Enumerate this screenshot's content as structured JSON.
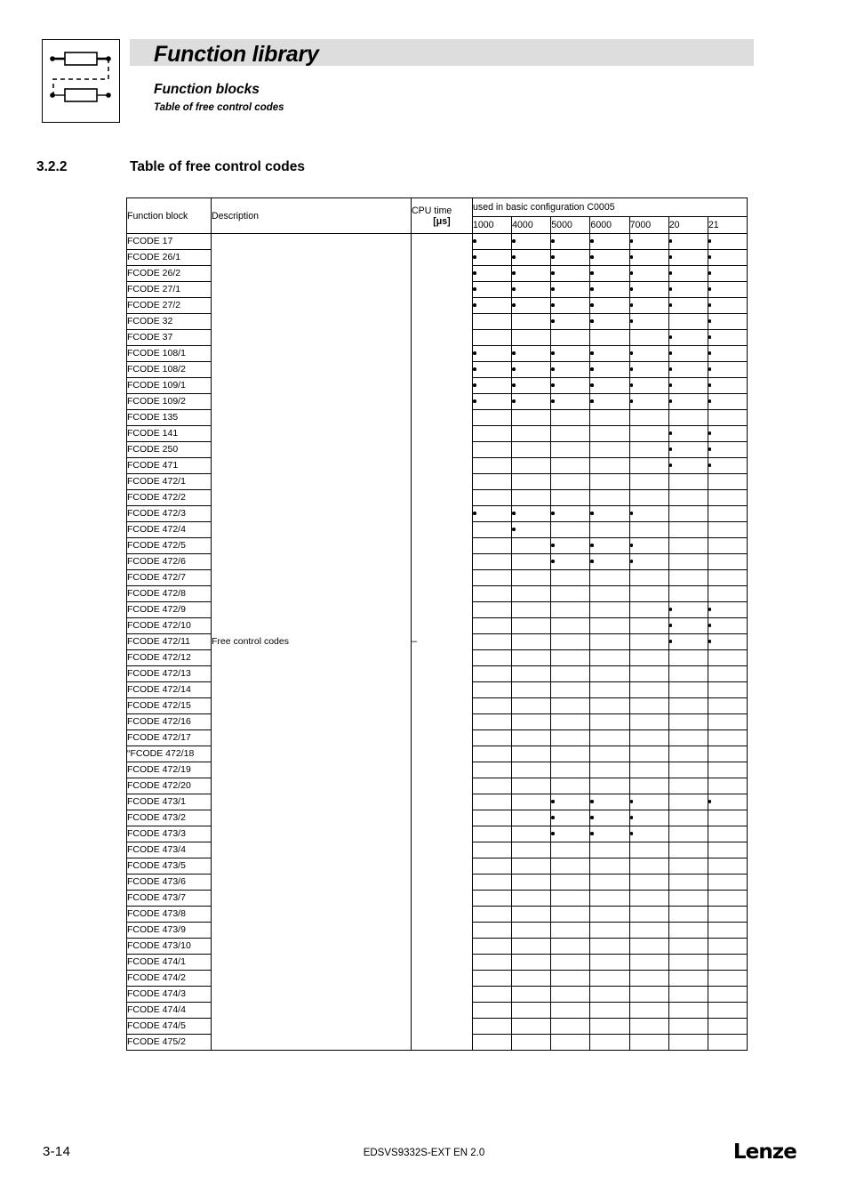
{
  "header": {
    "title": "Function library",
    "subtitle": "Function blocks",
    "subsubtitle": "Table of free control codes",
    "icon_name": "function-block-diagram-icon"
  },
  "section": {
    "number": "3.2.2",
    "title": "Table of free control codes"
  },
  "table": {
    "columns": {
      "function_block": "Function block",
      "description": "Description",
      "cpu_time": "CPU time",
      "cpu_time_unit": "[μs]",
      "config_group": "used in basic configuration C0005",
      "config_columns": [
        "1000",
        "4000",
        "5000",
        "6000",
        "7000",
        "20",
        "21"
      ]
    },
    "dot_glyph": "•",
    "description_value": "Free control codes",
    "cpu_time_value": "–",
    "rows": [
      {
        "name": "FCODE 17",
        "flags": [
          1,
          1,
          1,
          1,
          1,
          1,
          1
        ]
      },
      {
        "name": "FCODE 26/1",
        "flags": [
          1,
          1,
          1,
          1,
          1,
          1,
          1
        ]
      },
      {
        "name": "FCODE 26/2",
        "flags": [
          1,
          1,
          1,
          1,
          1,
          1,
          1
        ]
      },
      {
        "name": "FCODE 27/1",
        "flags": [
          1,
          1,
          1,
          1,
          1,
          1,
          1
        ]
      },
      {
        "name": "FCODE 27/2",
        "flags": [
          1,
          1,
          1,
          1,
          1,
          1,
          1
        ]
      },
      {
        "name": "FCODE 32",
        "flags": [
          0,
          0,
          1,
          1,
          1,
          0,
          1
        ]
      },
      {
        "name": "FCODE 37",
        "flags": [
          0,
          0,
          0,
          0,
          0,
          1,
          1
        ]
      },
      {
        "name": "FCODE 108/1",
        "flags": [
          1,
          1,
          1,
          1,
          1,
          1,
          1
        ]
      },
      {
        "name": "FCODE 108/2",
        "flags": [
          1,
          1,
          1,
          1,
          1,
          1,
          1
        ]
      },
      {
        "name": "FCODE 109/1",
        "flags": [
          1,
          1,
          1,
          1,
          1,
          1,
          1
        ]
      },
      {
        "name": "FCODE 109/2",
        "flags": [
          1,
          1,
          1,
          1,
          1,
          1,
          1
        ]
      },
      {
        "name": "FCODE 135",
        "flags": [
          0,
          0,
          0,
          0,
          0,
          0,
          0
        ]
      },
      {
        "name": "FCODE 141",
        "flags": [
          0,
          0,
          0,
          0,
          0,
          1,
          1
        ]
      },
      {
        "name": "FCODE 250",
        "flags": [
          0,
          0,
          0,
          0,
          0,
          1,
          1
        ]
      },
      {
        "name": "FCODE 471",
        "flags": [
          0,
          0,
          0,
          0,
          0,
          1,
          1
        ]
      },
      {
        "name": "FCODE 472/1",
        "flags": [
          0,
          0,
          0,
          0,
          0,
          0,
          0
        ]
      },
      {
        "name": "FCODE 472/2",
        "flags": [
          0,
          0,
          0,
          0,
          0,
          0,
          0
        ]
      },
      {
        "name": "FCODE 472/3",
        "flags": [
          1,
          1,
          1,
          1,
          1,
          0,
          0
        ]
      },
      {
        "name": "FCODE 472/4",
        "flags": [
          0,
          1,
          0,
          0,
          0,
          0,
          0
        ]
      },
      {
        "name": "FCODE 472/5",
        "flags": [
          0,
          0,
          1,
          1,
          1,
          0,
          0
        ]
      },
      {
        "name": "FCODE 472/6",
        "flags": [
          0,
          0,
          1,
          1,
          1,
          0,
          0
        ]
      },
      {
        "name": "FCODE 472/7",
        "flags": [
          0,
          0,
          0,
          0,
          0,
          0,
          0
        ]
      },
      {
        "name": "FCODE 472/8",
        "flags": [
          0,
          0,
          0,
          0,
          0,
          0,
          0
        ]
      },
      {
        "name": "FCODE 472/9",
        "flags": [
          0,
          0,
          0,
          0,
          0,
          1,
          1
        ]
      },
      {
        "name": "FCODE 472/10",
        "flags": [
          0,
          0,
          0,
          0,
          0,
          1,
          1
        ]
      },
      {
        "name": "FCODE 472/11",
        "flags": [
          0,
          0,
          0,
          0,
          0,
          1,
          1
        ]
      },
      {
        "name": "FCODE 472/12",
        "flags": [
          0,
          0,
          0,
          0,
          0,
          0,
          0
        ]
      },
      {
        "name": "FCODE 472/13",
        "flags": [
          0,
          0,
          0,
          0,
          0,
          0,
          0
        ]
      },
      {
        "name": "FCODE 472/14",
        "flags": [
          0,
          0,
          0,
          0,
          0,
          0,
          0
        ]
      },
      {
        "name": "FCODE 472/15",
        "flags": [
          0,
          0,
          0,
          0,
          0,
          0,
          0
        ]
      },
      {
        "name": "FCODE 472/16",
        "flags": [
          0,
          0,
          0,
          0,
          0,
          0,
          0
        ]
      },
      {
        "name": "FCODE 472/17",
        "flags": [
          0,
          0,
          0,
          0,
          0,
          0,
          0
        ]
      },
      {
        "name": "“FCODE 472/18",
        "flags": [
          0,
          0,
          0,
          0,
          0,
          0,
          0
        ]
      },
      {
        "name": "FCODE 472/19",
        "flags": [
          0,
          0,
          0,
          0,
          0,
          0,
          0
        ]
      },
      {
        "name": "FCODE 472/20",
        "flags": [
          0,
          0,
          0,
          0,
          0,
          0,
          0
        ]
      },
      {
        "name": "FCODE 473/1",
        "flags": [
          0,
          0,
          1,
          1,
          1,
          0,
          1
        ]
      },
      {
        "name": "FCODE 473/2",
        "flags": [
          0,
          0,
          1,
          1,
          1,
          0,
          0
        ]
      },
      {
        "name": "FCODE 473/3",
        "flags": [
          0,
          0,
          1,
          1,
          1,
          0,
          0
        ]
      },
      {
        "name": "FCODE 473/4",
        "flags": [
          0,
          0,
          0,
          0,
          0,
          0,
          0
        ]
      },
      {
        "name": "FCODE 473/5",
        "flags": [
          0,
          0,
          0,
          0,
          0,
          0,
          0
        ]
      },
      {
        "name": "FCODE 473/6",
        "flags": [
          0,
          0,
          0,
          0,
          0,
          0,
          0
        ]
      },
      {
        "name": "FCODE 473/7",
        "flags": [
          0,
          0,
          0,
          0,
          0,
          0,
          0
        ]
      },
      {
        "name": "FCODE 473/8",
        "flags": [
          0,
          0,
          0,
          0,
          0,
          0,
          0
        ]
      },
      {
        "name": "FCODE 473/9",
        "flags": [
          0,
          0,
          0,
          0,
          0,
          0,
          0
        ]
      },
      {
        "name": "FCODE 473/10",
        "flags": [
          0,
          0,
          0,
          0,
          0,
          0,
          0
        ]
      },
      {
        "name": "FCODE 474/1",
        "flags": [
          0,
          0,
          0,
          0,
          0,
          0,
          0
        ]
      },
      {
        "name": "FCODE 474/2",
        "flags": [
          0,
          0,
          0,
          0,
          0,
          0,
          0
        ]
      },
      {
        "name": "FCODE 474/3",
        "flags": [
          0,
          0,
          0,
          0,
          0,
          0,
          0
        ]
      },
      {
        "name": "FCODE 474/4",
        "flags": [
          0,
          0,
          0,
          0,
          0,
          0,
          0
        ]
      },
      {
        "name": "FCODE 474/5",
        "flags": [
          0,
          0,
          0,
          0,
          0,
          0,
          0
        ]
      },
      {
        "name": "FCODE 475/2",
        "flags": [
          0,
          0,
          0,
          0,
          0,
          0,
          0
        ]
      }
    ]
  },
  "footer": {
    "page_number": "3-14",
    "document_id": "EDSVS9332S-EXT EN 2.0",
    "logo": "Lenze"
  }
}
